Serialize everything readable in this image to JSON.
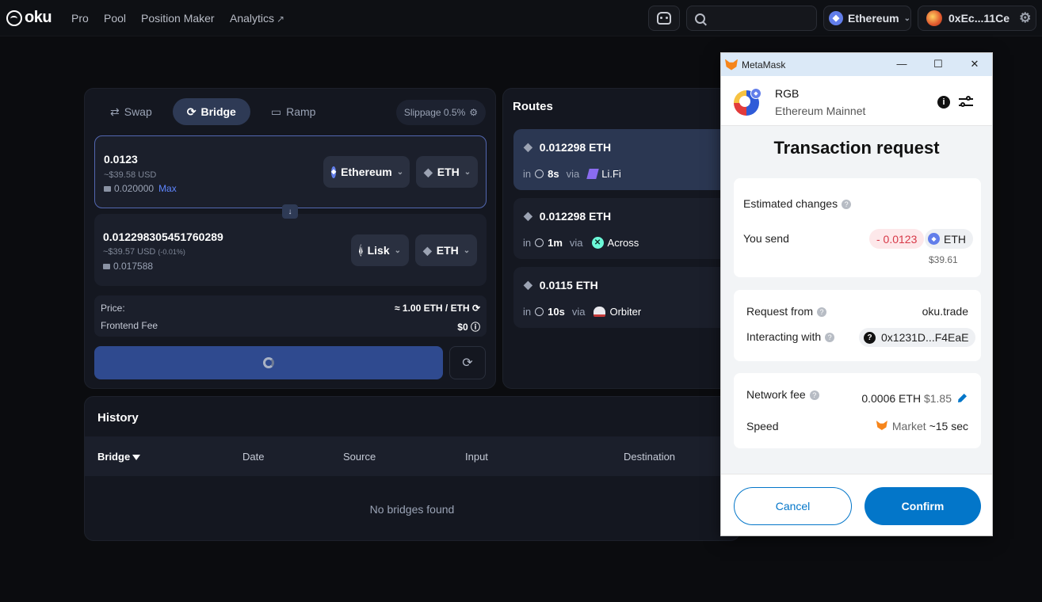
{
  "nav": {
    "logo_text": "oku",
    "links": [
      "Pro",
      "Pool",
      "Position Maker",
      "Analytics"
    ],
    "external_icon": "↗",
    "search_placeholder": "",
    "network": "Ethereum",
    "wallet": "0xEc...11Ce"
  },
  "swap": {
    "tabs": [
      "Swap",
      "Bridge",
      "Ramp"
    ],
    "active_tab": "Bridge",
    "slippage": "Slippage 0.5%",
    "from": {
      "amount": "0.0123",
      "usd": "~$39.58 USD",
      "balance": "0.020000",
      "max": "Max",
      "chain": "Ethereum",
      "token": "ETH"
    },
    "to": {
      "amount": "0.012298305451760289",
      "usd": "~$39.57 USD",
      "usd_pct": "(-0.01%)",
      "balance": "0.017588",
      "chain": "Lisk",
      "token": "ETH"
    },
    "price_label": "Price:",
    "price_value": "≈ 1.00 ETH / ETH",
    "fee_label": "Frontend Fee",
    "fee_value": "$0"
  },
  "routes": {
    "title": "Routes",
    "items": [
      {
        "amount": "0.012298 ETH",
        "in": "in",
        "time": "8s",
        "via": "via",
        "provider": "Li.Fi"
      },
      {
        "amount": "0.012298 ETH",
        "in": "in",
        "time": "1m",
        "via": "via",
        "provider": "Across"
      },
      {
        "amount": "0.0115 ETH",
        "in": "in",
        "time": "10s",
        "via": "via",
        "provider": "Orbiter"
      }
    ]
  },
  "history": {
    "title": "History",
    "columns": [
      "Bridge",
      "Date",
      "Source",
      "Input",
      "Destination"
    ],
    "empty": "No bridges found"
  },
  "metamask": {
    "window_title": "MetaMask",
    "site_name": "RGB",
    "network": "Ethereum Mainnet",
    "heading": "Transaction request",
    "estimated_changes": "Estimated changes",
    "you_send": "You send",
    "send_amount": "- 0.0123",
    "send_token": "ETH",
    "send_usd": "$39.61",
    "request_from_label": "Request from",
    "request_from": "oku.trade",
    "interacting_label": "Interacting with",
    "interacting": "0x1231D...F4EaE",
    "network_fee_label": "Network fee",
    "network_fee": "0.0006 ETH",
    "network_fee_usd": "$1.85",
    "speed_label": "Speed",
    "speed_mode": "Market",
    "speed_time": "~15 sec",
    "cancel": "Cancel",
    "confirm": "Confirm"
  },
  "colors": {
    "background": "#0b0c0f",
    "panel": "#141720",
    "accent": "#2f4a8f",
    "metamask_blue": "#0376c9"
  }
}
